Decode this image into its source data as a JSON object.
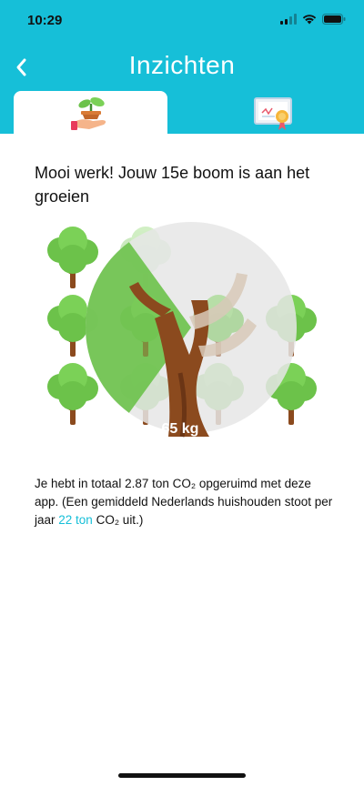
{
  "status_bar": {
    "time": "10:29"
  },
  "header": {
    "title": "Inzichten"
  },
  "tabs": [
    {
      "icon": "plant-in-hand-icon",
      "active": true
    },
    {
      "icon": "certificate-icon",
      "active": false
    }
  ],
  "content": {
    "message": "Mooi werk! Jouw 15e boom is aan het groeien",
    "tree_label": "65 kg",
    "tree_progress_percent": 30,
    "info_part1": "Je hebt in totaal 2.87 ton CO₂ opgeruimd met deze app. (Een gemiddeld Nederlands huishouden stoot per jaar ",
    "info_link": "22 ton",
    "info_part2": " CO₂ uit.)"
  },
  "colors": {
    "accent": "#16bfd8",
    "tree_green": "#6cc24a",
    "trunk_brown": "#8b4a1e"
  }
}
